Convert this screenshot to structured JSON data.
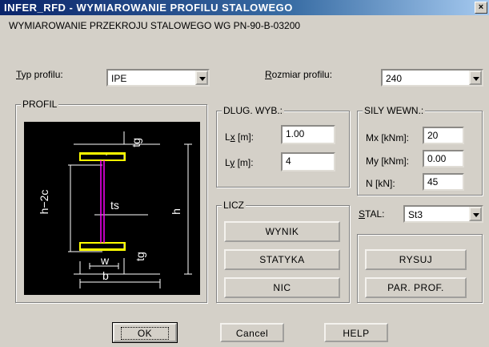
{
  "window": {
    "title": "INFER_RFD - WYMIAROWANIE PROFILU STALOWEGO",
    "close_glyph": "×",
    "subtitle": "WYMIAROWANIE PRZEKROJU STALOWEGO WG PN-90-B-03200"
  },
  "profile_type": {
    "label_ul": "T",
    "label_rest": "yp profilu:",
    "value": "IPE"
  },
  "profile_size": {
    "label_ul": "R",
    "label_rest": "ozmiar profilu:",
    "value": "240"
  },
  "profil_group": {
    "title": "PROFIL",
    "drawing_labels": {
      "tg_top": "tg",
      "h2c": "h−2c",
      "h": "h",
      "ts": "ts",
      "tg_bottom": "tg",
      "w": "w",
      "b": "b"
    },
    "colors": {
      "flange": "#ffff00",
      "web": "#ff00ff",
      "dims": "#ffffff"
    }
  },
  "length_group": {
    "title": "DLUG. WYB.:",
    "lx": {
      "label_pre": "L",
      "label_ul": "x",
      "label_post": "  [m]:",
      "value": "1.00"
    },
    "ly": {
      "label_pre": "L",
      "label_ul": "y",
      "label_post": "  [m]:",
      "value": "4"
    }
  },
  "forces_group": {
    "title": "SILY WEWN.:",
    "mx": {
      "label": "Mx [kNm]:",
      "value": "20"
    },
    "my": {
      "label": "My [kNm]:",
      "value": "0.00"
    },
    "n": {
      "label": "N [kN]:",
      "value": "45"
    }
  },
  "licz_group": {
    "title": "LICZ",
    "buttons": [
      "WYNIK",
      "STATYKA",
      "NIC"
    ]
  },
  "steel": {
    "label_ul": "S",
    "label_rest": "TAL:",
    "value": "St3"
  },
  "draw_group": {
    "buttons": [
      "RYSUJ",
      "PAR. PROF."
    ]
  },
  "footer": {
    "ok": "OK",
    "cancel": "Cancel",
    "help": "HELP"
  }
}
